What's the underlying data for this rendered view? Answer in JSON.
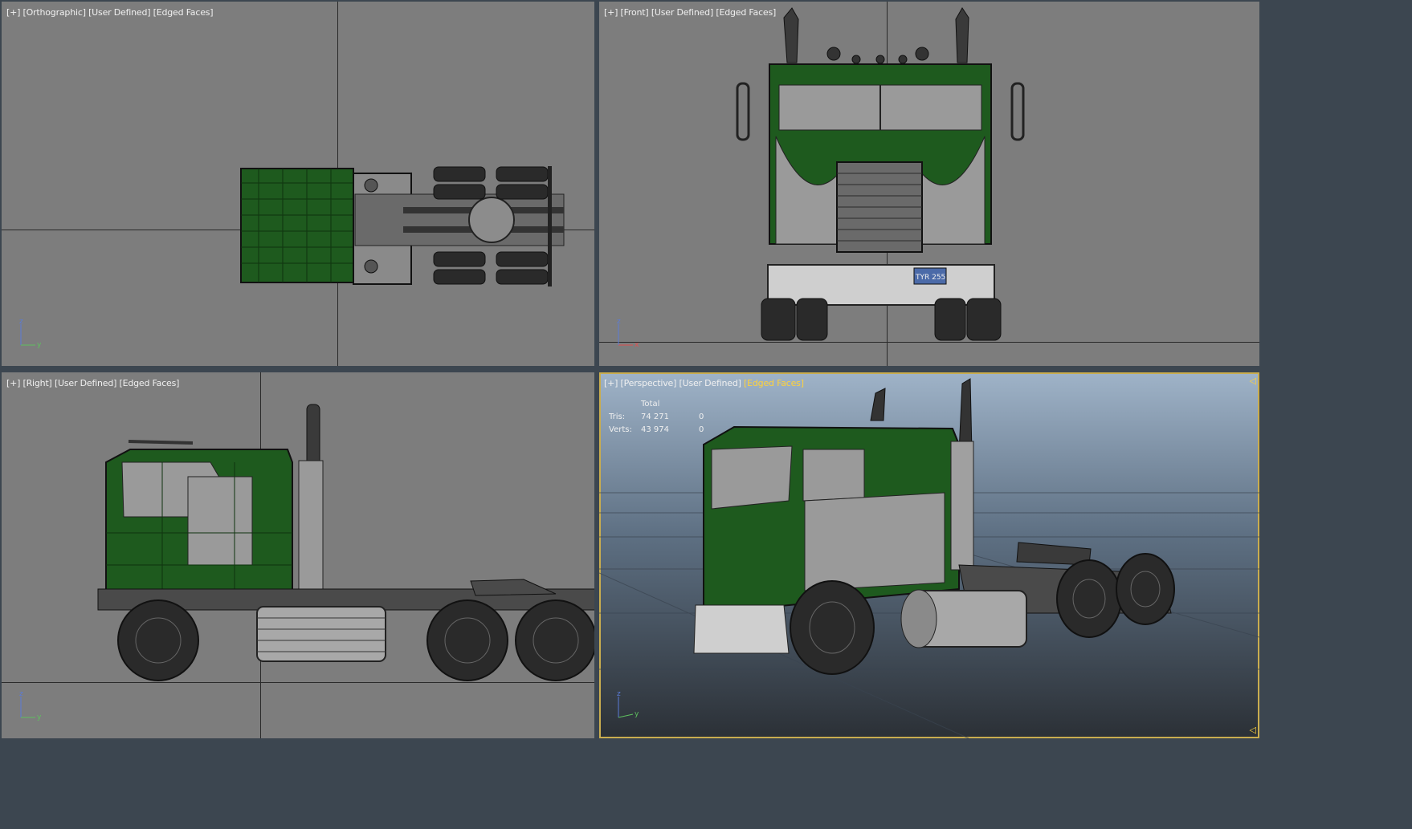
{
  "viewports": {
    "top_left": {
      "label_parts": [
        "[+]",
        "[Orthographic]",
        "[User Defined]",
        "[Edged Faces]"
      ],
      "axis": {
        "a": "z",
        "b": "y"
      }
    },
    "top_right": {
      "label_parts": [
        "[+]",
        "[Front]",
        "[User Defined]",
        "[Edged Faces]"
      ],
      "axis": {
        "a": "z",
        "b": "x"
      },
      "plate": "TYR 255"
    },
    "bottom_left": {
      "label_parts": [
        "[+]",
        "[Right]",
        "[User Defined]",
        "[Edged Faces]"
      ],
      "axis": {
        "a": "z",
        "b": "y"
      }
    },
    "bottom_right": {
      "label_parts": [
        "[+]",
        "[Perspective]",
        "[User Defined]",
        "[Edged Faces]"
      ],
      "axis": {
        "a": "z",
        "b": "y"
      },
      "stats": {
        "header": "Total",
        "rows": [
          {
            "label": "Tris:",
            "total": "74 271",
            "sel": "0"
          },
          {
            "label": "Verts:",
            "total": "43 974",
            "sel": "0"
          }
        ]
      }
    }
  },
  "colors": {
    "viewport_bg": "#7d7d7d",
    "truck_green": "#1e5a1e",
    "active_highlight": "#ffd23a"
  }
}
